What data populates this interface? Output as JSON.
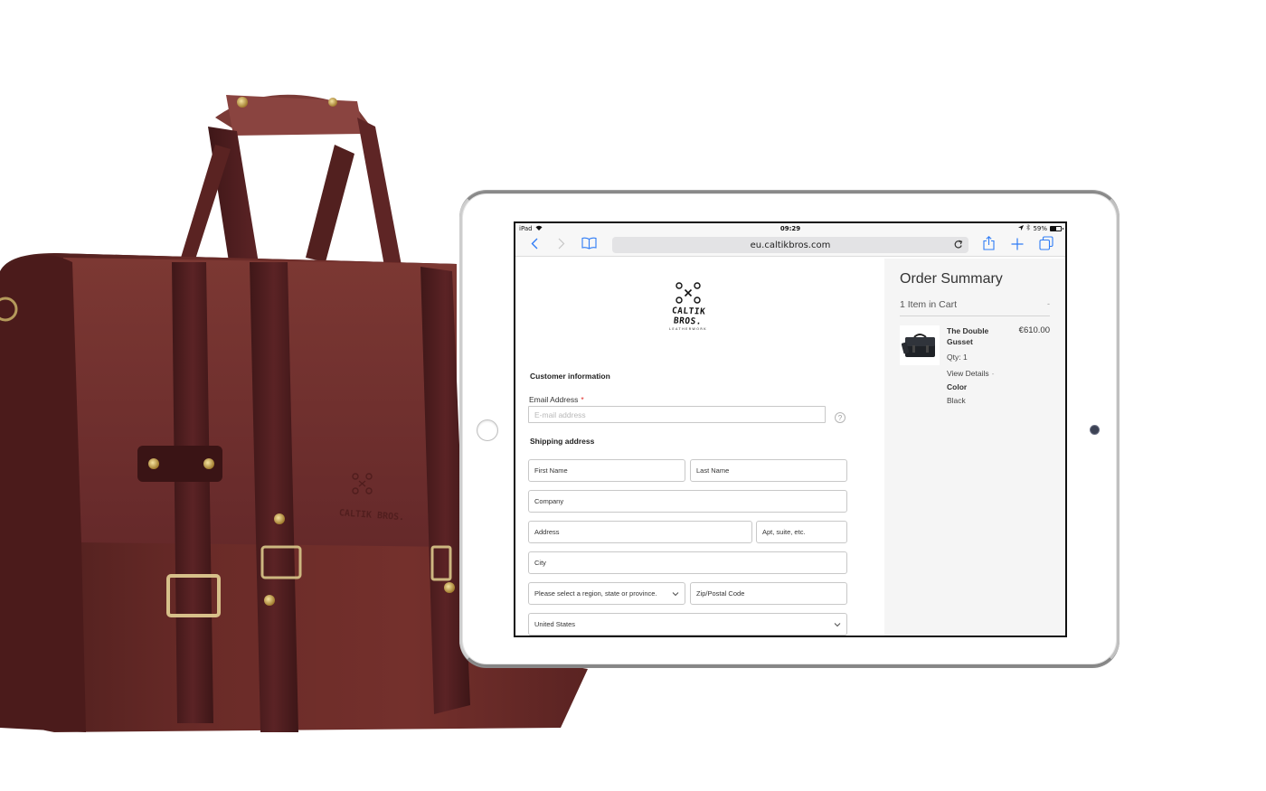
{
  "device": {
    "status_bar": {
      "carrier": "iPad",
      "time": "09:29",
      "battery": "59%"
    },
    "browser": {
      "url": "eu.caltikbros.com",
      "icons": [
        "back-icon",
        "forward-icon",
        "bookmarks-icon",
        "reload-icon",
        "share-icon",
        "new-tab-icon",
        "tabs-icon"
      ]
    }
  },
  "brand": {
    "name": "CALTIK BROS.",
    "tagline": "LEATHERWORK"
  },
  "checkout": {
    "customer_section_title": "Customer information",
    "email": {
      "label": "Email Address",
      "required_mark": "*",
      "placeholder": "E-mail address",
      "value": ""
    },
    "help_icon": "?",
    "shipping_section_title": "Shipping address",
    "fields": {
      "first_name": "First Name",
      "last_name": "Last Name",
      "company": "Company",
      "address": "Address",
      "apt": "Apt, suite, etc.",
      "city": "City",
      "region": "Please select a region, state or province.",
      "zip": "Zip/Postal Code",
      "country": "United States"
    }
  },
  "order_summary": {
    "title": "Order Summary",
    "items_count": "1 Item in Cart",
    "toggle": "-",
    "items": [
      {
        "name": "The Double Gusset",
        "qty": "Qty: 1",
        "price": "€610.00",
        "view_details": "View Details",
        "details_toggle": "-",
        "option_label": "Color",
        "option_value": "Black"
      }
    ]
  },
  "colors": {
    "ios_blue": "#2f7cf6",
    "required_red": "#e02b27",
    "leather_brown": "#6b2a27",
    "sidebar_bg": "#f5f5f5"
  }
}
